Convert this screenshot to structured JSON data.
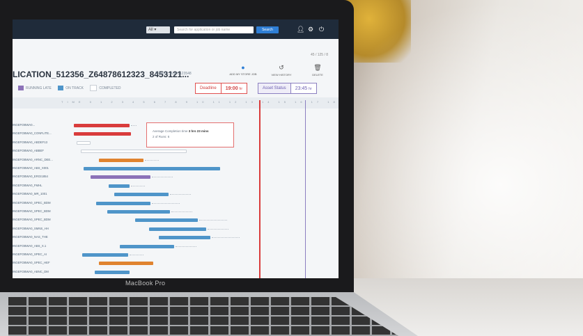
{
  "app": {
    "search": {
      "select_value": "All",
      "placeholder": "Search for application or job name",
      "button": "Search"
    },
    "title": "LICATION_512356_Z64878612323_8453121...",
    "subtitle": "KUA001_ASPC123548",
    "pager": "45 / 125 / 8",
    "actions": [
      {
        "label": "ADD MY STORE JOB",
        "icon": "plus-circle-icon"
      },
      {
        "label": "VIEW HISTORY",
        "icon": "history-icon"
      },
      {
        "label": "DELETE",
        "icon": "trash-icon"
      }
    ],
    "legend": [
      {
        "label": "RUNNING LATE",
        "color": "#8c72b8"
      },
      {
        "label": "ON TRACK",
        "color": "#4f95c9"
      },
      {
        "label": "COMPLETED",
        "color": "#ffffff"
      }
    ],
    "deadline": {
      "label": "Deadline",
      "value": "19:00",
      "unit": "hr"
    },
    "asset_status": {
      "label": "Asset Status",
      "value": "23:45",
      "unit": "hr"
    },
    "timeline_label": "TIME",
    "ticks": [
      "0",
      "1",
      "2",
      "3",
      "4",
      "5",
      "6",
      "7",
      "8",
      "9",
      "10",
      "11",
      "12",
      "13",
      "14",
      "15",
      "16",
      "17",
      "18",
      "19",
      "20"
    ],
    "rows": [
      "INGEFOBWA0...",
      "INGEFOBWA0_CONFLITE...",
      "INGEFOBWA0_ABDEF13",
      "INGEFOBWA0_ABBEF",
      "INGEFOBWA0_ARNC_DEE...",
      "INGEFOBWA0_ABS_X001",
      "INGEFOBWA0_ERGI1854",
      "INGEFOBWA0_FMHL",
      "INGEFOBWA0_MR_1001",
      "INGEFOBWA0_SPEC_BDM",
      "INGEFOBWA0_SPEC_BDM",
      "INGEFOBWA0_SPEC_BDM",
      "INGEFOBWA0_SMNS_HH",
      "INGEFOBWA0_NAS_THE",
      "INGEFOBWA0_ABS_X.1",
      "INGEFOBWA0_SPEC_AI",
      "INGEFOBWA0_SPEC_HEF",
      "INGEFOBWA0_ABNC_DM",
      "INGEFOBWA0_SPC_THE"
    ],
    "tooltip": {
      "line1_prefix": "Average Completion time",
      "line1_value": "3 hrs 23 mins",
      "line2": "2 of Runs: 6"
    }
  },
  "device": {
    "brand": "MacBook Pro"
  }
}
